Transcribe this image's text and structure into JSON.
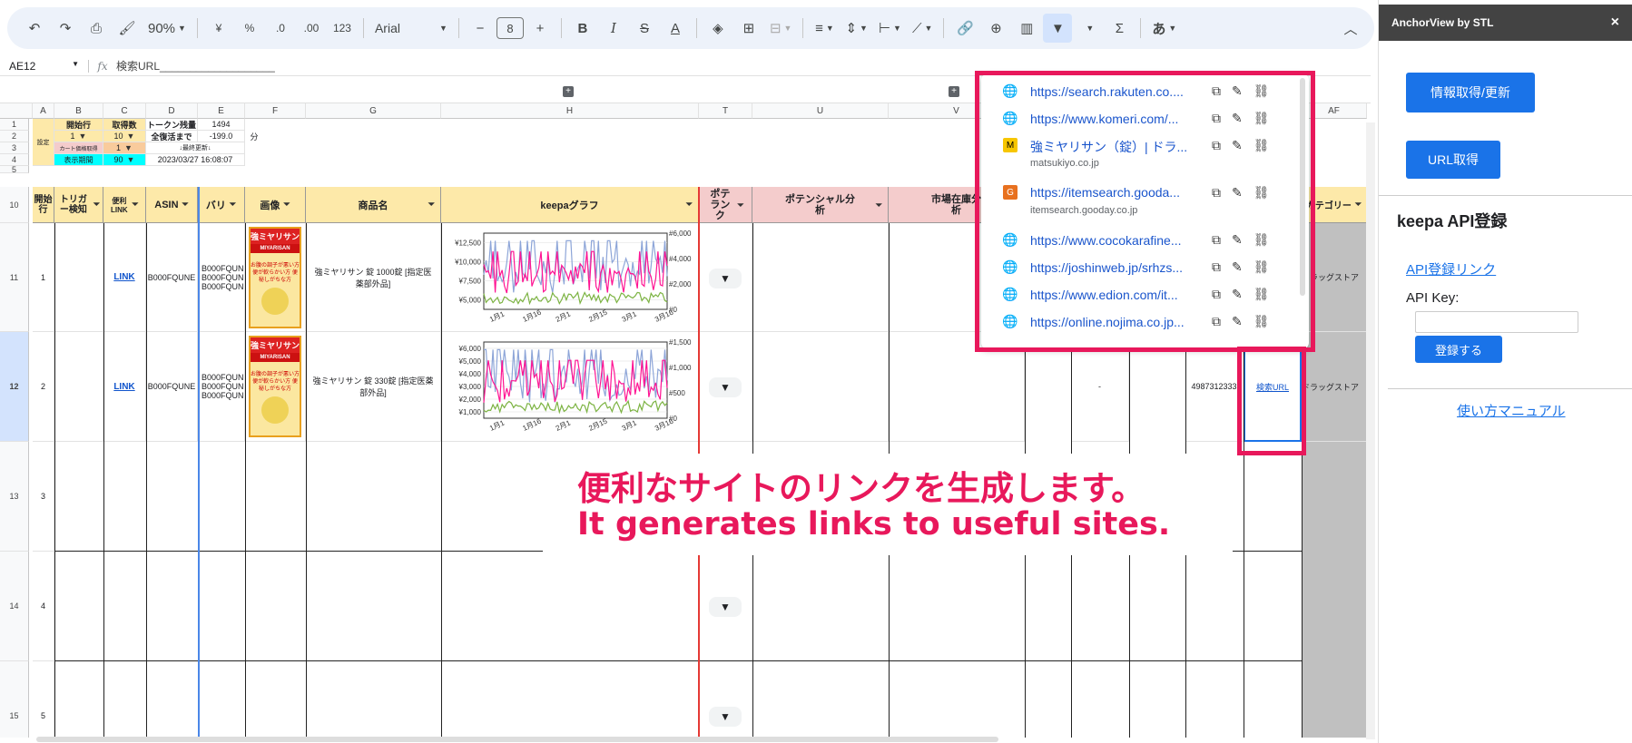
{
  "toolbar": {
    "zoom": "90%",
    "currency": "¥",
    "percent": "%",
    "dec_decrease": ".0",
    "dec_increase": ".00",
    "number_format": "123",
    "font": "Arial",
    "font_size": "8",
    "bold": "B",
    "italic": "I",
    "strike": "S",
    "text_color": "A",
    "sigma": "Σ",
    "ime": "あ"
  },
  "formula_bar": {
    "cell_ref": "AE12",
    "fx": "fx",
    "content": "検索URL___________________"
  },
  "columns": [
    "A",
    "B",
    "C",
    "D",
    "E",
    "F",
    "G",
    "H",
    "T",
    "U",
    "V",
    "AF"
  ],
  "rows": [
    "1",
    "2",
    "3",
    "4",
    "5",
    "10",
    "11",
    "12",
    "13",
    "14",
    "15"
  ],
  "settings": {
    "label": "設定",
    "start_row_label": "開始行",
    "fetch_count_label": "取得数",
    "token_label": "トークン残量",
    "token_value": "1494",
    "start_row_value": "1",
    "fetch_count_value": "10",
    "recovery_label": "全復活まで",
    "recovery_value": "-199.0",
    "recovery_unit": "分",
    "cart_label": "カート価格取得",
    "cart_value": "1",
    "last_update_label": "↓最終更新↓",
    "display_period_label": "表示期間",
    "display_period_value": "90",
    "last_update_value": "2023/03/27 16:08:07"
  },
  "headers": {
    "start": "開始行",
    "trigger": "トリガー検知",
    "link": "便利LINK",
    "asin": "ASIN",
    "vari": "バリ",
    "image": "画像",
    "product": "商品名",
    "keepa": "keepaグラフ",
    "pote_rank": "ポテランク",
    "potential": "ポテンシャル分析",
    "market_stock": "市場在庫分析",
    "category": "カテゴリー"
  },
  "rows_data": [
    {
      "num": "1",
      "link": "LINK",
      "asin": "B000FQUNE",
      "vari": "B000FQUN",
      "vari2": "B000FQUN",
      "vari3": "B000FQUN",
      "product": "強ミヤリサン 錠 1000錠 [指定医薬部外品]",
      "category": "ドラッグストア"
    },
    {
      "num": "2",
      "link": "LINK",
      "asin": "B000FQUNE",
      "vari": "B000FQUN",
      "vari2": "B000FQUN",
      "vari3": "B000FQUN",
      "product": "強ミヤリサン 錠 330錠 [指定医薬部外品]",
      "category": "ドラッグストア",
      "dash": "-",
      "jan": "4987312333",
      "search_url": "検索URL"
    },
    {
      "num": "3"
    },
    {
      "num": "4"
    },
    {
      "num": "5"
    }
  ],
  "product_image": {
    "brand": "強ミヤリサン",
    "sub": "MIYARISAN",
    "tagline": "お腹の調子が悪い方 便が軟らかい方 便秘しがちな方"
  },
  "chart1": {
    "y_labels": [
      "¥12,500",
      "¥10,000",
      "¥7,500",
      "¥5,000"
    ],
    "y2_labels": [
      "#6,000",
      "#4,000",
      "#2,000",
      "#0"
    ],
    "x_labels": [
      "1月1",
      "1月16",
      "2月1",
      "2月15",
      "3月1",
      "3月16"
    ]
  },
  "chart2": {
    "y_labels": [
      "¥6,000",
      "¥5,000",
      "¥4,000",
      "¥3,000",
      "¥2,000",
      "¥1,000"
    ],
    "y2_labels": [
      "#1,500",
      "#1,000",
      "#500",
      "#0"
    ],
    "x_labels": [
      "1月1",
      "1月16",
      "2月1",
      "2月15",
      "3月1",
      "3月16"
    ]
  },
  "link_popup": [
    {
      "url": "https://search.rakuten.co....",
      "icon": "globe-icon"
    },
    {
      "url": "https://www.komeri.com/...",
      "icon": "globe-icon"
    },
    {
      "url": "強ミヤリサン（錠）| ドラ...",
      "icon": "matsukiyo-icon",
      "sub": "matsukiyo.co.jp"
    },
    {
      "url": "https://itemsearch.gooda...",
      "icon": "gooday-icon",
      "sub": "itemsearch.gooday.co.jp"
    },
    {
      "url": "https://www.cocokarafine...",
      "icon": "globe-icon"
    },
    {
      "url": "https://joshinweb.jp/srhzs...",
      "icon": "globe-icon"
    },
    {
      "url": "https://www.edion.com/it...",
      "icon": "globe-icon"
    },
    {
      "url": "https://online.nojima.co.jp...",
      "icon": "globe-icon"
    }
  ],
  "overlay": {
    "line1": "便利なサイトのリンクを生成します。",
    "line2": "It generates links to useful sites."
  },
  "sidebar": {
    "title": "AnchorView by STL",
    "close": "×",
    "refresh_button": "情報取得/更新",
    "url_button": "URL取得",
    "keepa_title": "keepa API登録",
    "api_link": "API登録リンク",
    "api_key_label": "API Key:",
    "register_button": "登録する",
    "manual_link": "使い方マニュアル"
  },
  "colors": {
    "accent": "#1a73e8",
    "highlight": "#e8185b",
    "header_yellow": "#fde9a9",
    "header_pink": "#f4cccc"
  }
}
